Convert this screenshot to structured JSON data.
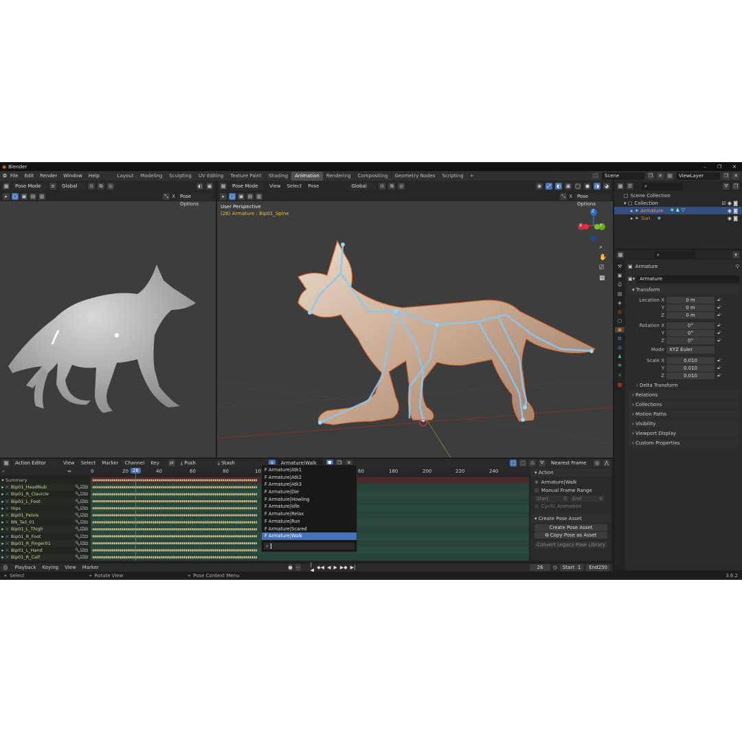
{
  "window": {
    "title": "Blender",
    "version": "3.6.2"
  },
  "menubar": [
    "File",
    "Edit",
    "Render",
    "Window",
    "Help"
  ],
  "workspaces": [
    "Layout",
    "Modeling",
    "Sculpting",
    "UV Editing",
    "Texture Paint",
    "Shading",
    "Animation",
    "Rendering",
    "Compositing",
    "Geometry Nodes",
    "Scripting"
  ],
  "active_workspace": "Animation",
  "scene": {
    "label": "Scene",
    "viewlayer": "ViewLayer"
  },
  "left_viewport": {
    "mode": "Pose Mode",
    "orientation": "Global",
    "pose_options": "Pose Options",
    "xmark": "X"
  },
  "main_viewport": {
    "mode": "Pose Mode",
    "menus": [
      "View",
      "Select",
      "Pose"
    ],
    "orientation": "Global",
    "pose_options": "Pose Options",
    "xmark": "X",
    "perspective": "User Perspective",
    "active": "(26) Armature : Bip01_Spine",
    "gizmo": {
      "z": "Z",
      "y": "Y",
      "x": "X"
    }
  },
  "outliner": {
    "root": "Scene Collection",
    "collection": "Collection",
    "items": [
      "Armature",
      "Sun"
    ]
  },
  "properties": {
    "object_name": "Armature",
    "data_name": "Armature",
    "transform_label": "Transform",
    "location": {
      "label": "Location X",
      "y": "Y",
      "z": "Z",
      "values": [
        "0 m",
        "0 m",
        "0 m"
      ]
    },
    "rotation": {
      "label": "Rotation X",
      "y": "Y",
      "z": "Z",
      "values": [
        "0°",
        "0°",
        "0°"
      ]
    },
    "mode": {
      "label": "Mode",
      "value": "XYZ Euler"
    },
    "scale": {
      "label": "Scale X",
      "y": "Y",
      "z": "Z",
      "values": [
        "0.010",
        "0.010",
        "0.010"
      ]
    },
    "delta": "Delta Transform",
    "sections": [
      "Relations",
      "Collections",
      "Motion Paths",
      "Visibility",
      "Viewport Display",
      "Custom Properties"
    ]
  },
  "dopesheet": {
    "editor": "Action Editor",
    "menus": [
      "View",
      "Select",
      "Marker",
      "Channel",
      "Key"
    ],
    "push_down": "Push Down",
    "stash": "Stash",
    "action": "Armature|Walk",
    "snap": "Nearest Frame",
    "ruler": [
      "0",
      "20",
      "26",
      "40",
      "60",
      "80",
      "10",
      "60",
      "180",
      "200",
      "220",
      "240"
    ],
    "channels": [
      "Summary",
      "Bip01_HeadNub",
      "Bip01_R_Clavicle",
      "Bip01_L_Foot",
      "Hips",
      "Bip01_Pelvis",
      "BN_Tail_01",
      "Bip01_L_Thigh",
      "Bip01_R_Foot",
      "Bip01_R_Finger01",
      "Bip01_L_Hand",
      "Bip01_R_Calf"
    ],
    "actions": [
      "F Armature|Atk1",
      "F Armature|Atk2",
      "F Armature|Atk3",
      "F Armature|Die",
      "F Armature|Howling",
      "F Armature|Idle",
      "F Armature|Relax",
      "F Armature|Run",
      "F Armature|Scared",
      "F Armature|Walk"
    ],
    "selected_action": "F Armature|Walk"
  },
  "side_panel": {
    "action_header": "Action",
    "action_name": "Armature|Walk",
    "manual_range": "Manual Frame Range",
    "start_label": "Start",
    "start_val": "0",
    "end_label": "End",
    "end_val": "0",
    "cyclic": "Cyclic Animation",
    "pose_header": "Create Pose Asset",
    "create_btn": "Create Pose Asset",
    "copy_btn": "Copy Pose as Asset",
    "convert_btn": "Convert Legacy Pose Library"
  },
  "timeline": {
    "menus": [
      "Playback",
      "Keying",
      "View",
      "Marker"
    ],
    "current": "26",
    "start_label": "Start",
    "start": "1",
    "end_label": "End",
    "end": "250"
  },
  "statusbar": {
    "select": "Select",
    "rotate": "Rotate View",
    "context": "Pose Context Menu"
  }
}
